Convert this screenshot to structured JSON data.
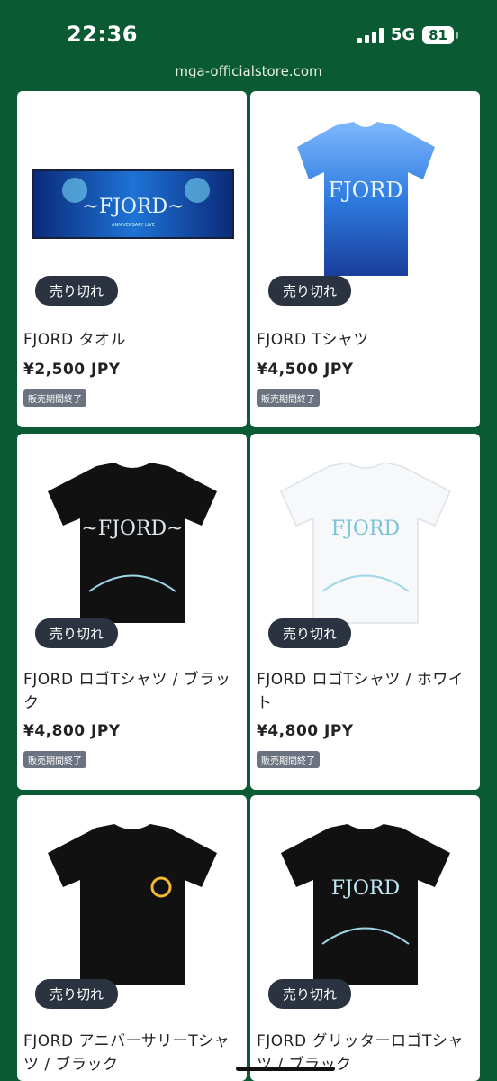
{
  "status_bar": {
    "time": "22:36",
    "network": "5G",
    "battery": "81"
  },
  "browser": {
    "url": "mga-officialstore.com"
  },
  "colors": {
    "header_bg": "#0a5a34",
    "soldout_bg": "#2b3340",
    "badge_bg": "#6b7280"
  },
  "products": [
    {
      "image": "towel",
      "soldout": "売り切れ",
      "name": "FJORD タオル",
      "price": "¥2,500 JPY",
      "badge": "販売期間終了"
    },
    {
      "image": "aurora-tshirt",
      "soldout": "売り切れ",
      "name": "FJORD Tシャツ",
      "price": "¥4,500 JPY",
      "badge": "販売期間終了"
    },
    {
      "image": "black-logo-tshirt",
      "soldout": "売り切れ",
      "name": "FJORD ロゴTシャツ / ブラック",
      "price": "¥4,800 JPY",
      "badge": "販売期間終了"
    },
    {
      "image": "white-logo-tshirt",
      "soldout": "売り切れ",
      "name": "FJORD ロゴTシャツ / ホワイト",
      "price": "¥4,800 JPY",
      "badge": "販売期間終了"
    },
    {
      "image": "anniversary-tshirt",
      "soldout": "売り切れ",
      "name": "FJORD アニバーサリーTシャツ / ブラック",
      "price": "",
      "badge": ""
    },
    {
      "image": "glitter-tshirt",
      "soldout": "売り切れ",
      "name": "FJORD グリッターロゴTシャツ / ブラック",
      "price": "",
      "badge": ""
    }
  ]
}
